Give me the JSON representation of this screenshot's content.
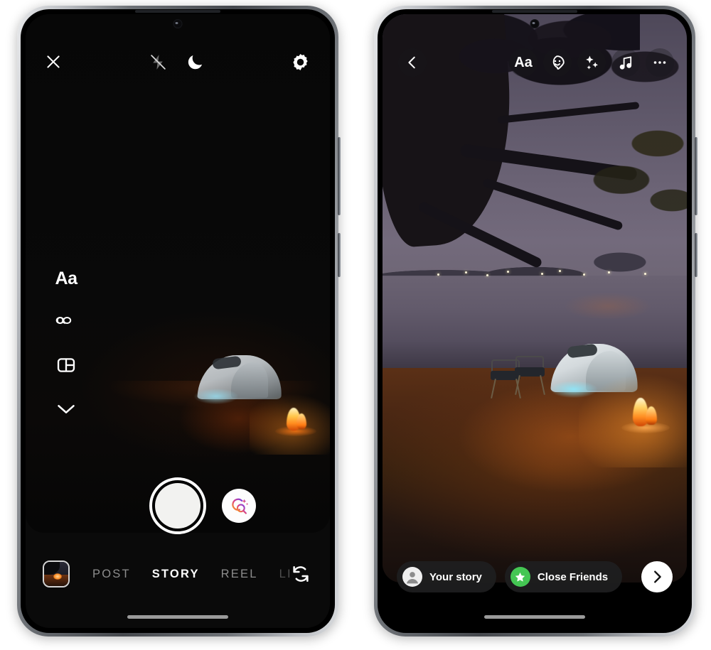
{
  "left_phone": {
    "screen_name": "instagram-camera-story-capture",
    "topbar": {
      "close_icon": "close-icon",
      "flash_icon": "flash-off-icon",
      "night_mode_icon": "moon-night-mode-icon",
      "settings_icon": "gear-settings-icon"
    },
    "tool_rail": [
      {
        "name": "text-tool",
        "label": "Aa",
        "icon": "text-aa-icon"
      },
      {
        "name": "boomerang-tool",
        "label": "",
        "icon": "infinity-boomerang-icon"
      },
      {
        "name": "layout-tool",
        "label": "",
        "icon": "layout-grid-icon"
      },
      {
        "name": "more-tools",
        "label": "",
        "icon": "chevron-down-icon"
      }
    ],
    "shutter": {
      "name": "shutter-button",
      "ai_button_icon": "ai-search-sparkle-icon"
    },
    "gallery": {
      "name": "gallery-thumbnail"
    },
    "modes": [
      {
        "label": "POST",
        "active": false,
        "faded": false
      },
      {
        "label": "STORY",
        "active": true,
        "faded": false
      },
      {
        "label": "REEL",
        "active": false,
        "faded": false
      },
      {
        "label": "LIV",
        "active": false,
        "faded": true
      }
    ],
    "flip_icon": "camera-flip-icon"
  },
  "right_phone": {
    "screen_name": "instagram-story-editor",
    "topbar": {
      "back_icon": "chevron-left-back-icon",
      "text_label": "Aa",
      "text_icon": "text-aa-icon",
      "sticker_icon": "sticker-smiley-icon",
      "effects_icon": "sparkles-effects-icon",
      "music_icon": "music-note-icon",
      "more_icon": "more-horizontal-icon"
    },
    "bottom": {
      "your_story_label": "Your story",
      "your_story_icon": "avatar-person-icon",
      "close_friends_label": "Close Friends",
      "close_friends_icon": "green-star-icon",
      "next_icon": "chevron-right-next-icon"
    }
  },
  "colors": {
    "accent_green": "#44c653",
    "screen_black": "#000000",
    "active_text": "#ffffff",
    "inactive_text": "#8d8d8d"
  }
}
